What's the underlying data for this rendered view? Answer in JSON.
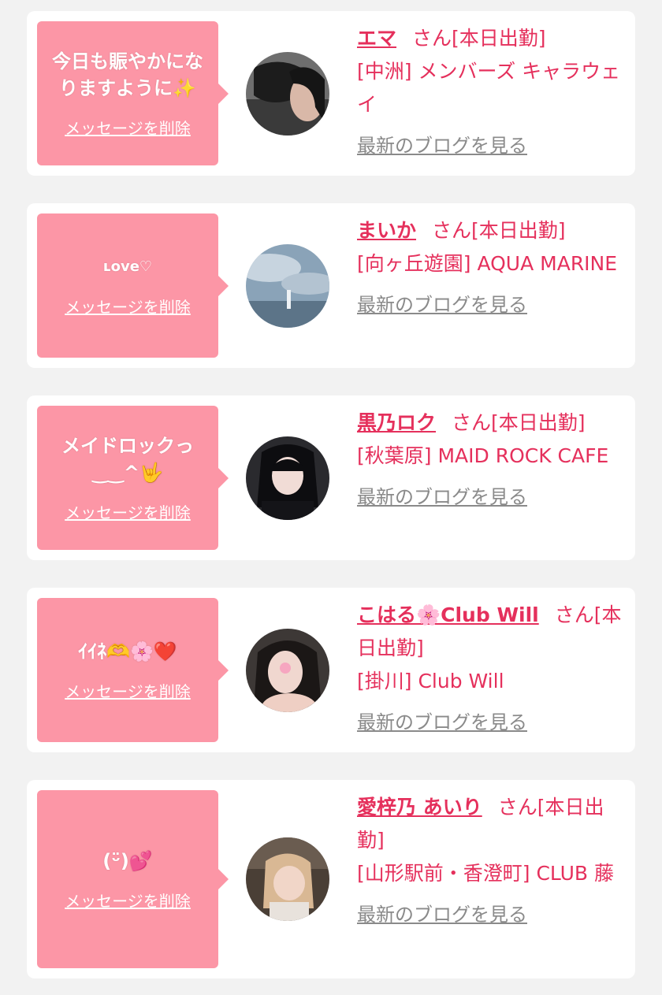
{
  "cards": [
    {
      "message": "今日も賑やかになりますように✨",
      "delete_label": "メッセージを削除",
      "name": "エマ",
      "san": "さん",
      "status": "[本日出勤]",
      "location": "[中洲] メンバーズ キャラウェイ",
      "blog_label": "最新のブログを見る"
    },
    {
      "message": "ʟove♡",
      "delete_label": "メッセージを削除",
      "name": "まいか",
      "san": "さん",
      "status": "[本日出勤]",
      "location": "[向ヶ丘遊園] AQUA MARINE",
      "blog_label": "最新のブログを見る"
    },
    {
      "message": "メイドロックっ‿‿^🤟",
      "delete_label": "メッセージを削除",
      "name": "黒乃ロク",
      "san": "さん",
      "status": "[本日出勤]",
      "location": "[秋葉原] MAID ROCK CAFE",
      "blog_label": "最新のブログを見る"
    },
    {
      "message": "ｲｲﾈ🫶🌸❤️",
      "delete_label": "メッセージを削除",
      "name": "こはる🌸Club Will",
      "san": "さん",
      "status": "[本日出勤]",
      "location": "[掛川] Club Will",
      "blog_label": "最新のブログを見る"
    },
    {
      "message": "(ᵕ̈)💕",
      "delete_label": "メッセージを削除",
      "name": "愛梓乃 あいり",
      "san": "さん",
      "status": "[本日出勤]",
      "location": "[山形駅前・香澄町] CLUB 藤",
      "blog_label": "最新のブログを見る"
    }
  ],
  "colors": {
    "page_bg": "#f2f2f2",
    "card_bg": "#ffffff",
    "bubble_bg": "#fc96a6",
    "accent": "#e5305c",
    "link_gray": "#8a8a8a"
  }
}
